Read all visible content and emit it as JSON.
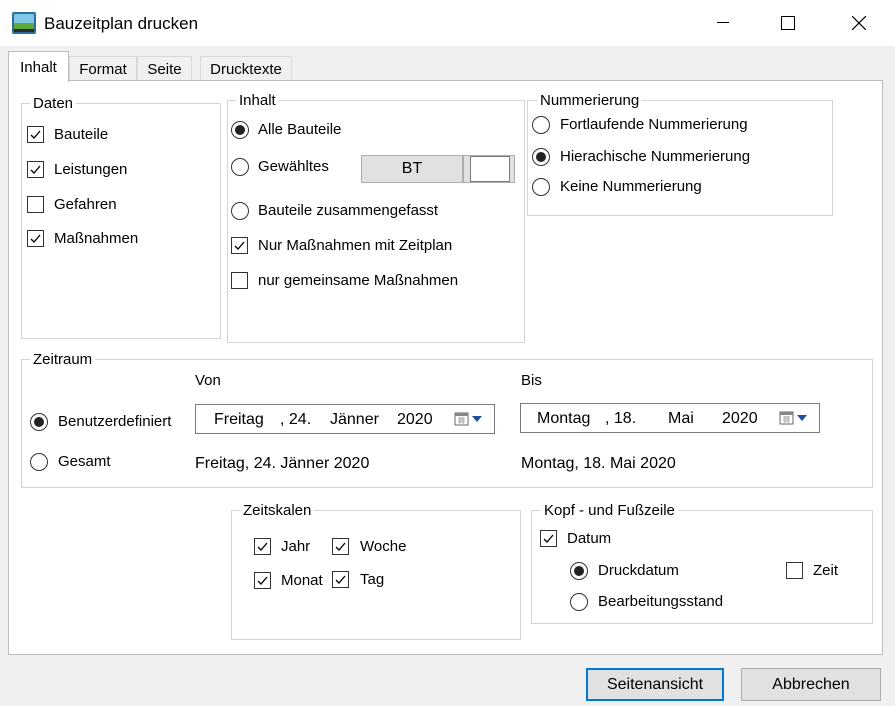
{
  "window": {
    "title": "Bauzeitplan drucken"
  },
  "tabs": [
    {
      "label": "Inhalt"
    },
    {
      "label": "Format"
    },
    {
      "label": "Seite"
    },
    {
      "label": "Drucktexte"
    }
  ],
  "daten": {
    "legend": "Daten",
    "items": [
      {
        "label": "Bauteile",
        "checked": true
      },
      {
        "label": "Leistungen",
        "checked": true
      },
      {
        "label": "Gefahren",
        "checked": false
      },
      {
        "label": "Maßnahmen",
        "checked": true
      }
    ]
  },
  "inhalt": {
    "legend": "Inhalt",
    "alle_bauteile": "Alle Bauteile",
    "gewaehltes": "Gewähltes",
    "bt_button": "BT",
    "zusammengefasst": "Bauteile zusammengefasst",
    "nur_zeitplan": "Nur Maßnahmen mit Zeitplan",
    "nur_gemeinsame": "nur gemeinsame Maßnahmen",
    "selected": "alle_bauteile"
  },
  "nummerierung": {
    "legend": "Nummerierung",
    "options": [
      {
        "label": "Fortlaufende Nummerierung",
        "selected": false
      },
      {
        "label": "Hierachische Nummerierung",
        "selected": true
      },
      {
        "label": "Keine Nummerierung",
        "selected": false
      }
    ]
  },
  "zeitraum": {
    "legend": "Zeitraum",
    "von_label": "Von",
    "bis_label": "Bis",
    "benutzerdefiniert": "Benutzerdefiniert",
    "gesamt": "Gesamt",
    "von": {
      "weekday": "Freitag",
      "day": ", 24.",
      "month": "Jänner",
      "year": "2020",
      "long": "Freitag, 24. Jänner 2020"
    },
    "bis": {
      "weekday": "Montag",
      "day": ", 18.",
      "month": "Mai",
      "year": "2020",
      "long": "Montag, 18. Mai 2020"
    }
  },
  "zeitskalen": {
    "legend": "Zeitskalen",
    "jahr": "Jahr",
    "woche": "Woche",
    "monat": "Monat",
    "tag": "Tag"
  },
  "kopf": {
    "legend": "Kopf - und Fußzeile",
    "datum": "Datum",
    "druckdatum": "Druckdatum",
    "bearbeitungsstand": "Bearbeitungsstand",
    "zeit": "Zeit"
  },
  "footer": {
    "seitenansicht": "Seitenansicht",
    "abbrechen": "Abbrechen"
  }
}
